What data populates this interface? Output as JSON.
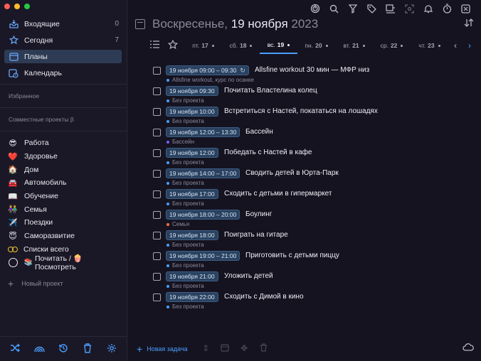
{
  "sidebar": {
    "nav": [
      {
        "label": "Входящие",
        "count": "0",
        "icon": "inbox-icon"
      },
      {
        "label": "Сегодня",
        "count": "7",
        "icon": "star-icon"
      },
      {
        "label": "Планы",
        "count": "",
        "icon": "plans-icon"
      },
      {
        "label": "Календарь",
        "count": "",
        "icon": "calendar-icon"
      }
    ],
    "favorites_label": "Избранное",
    "shared_label": "Совместные проекты β",
    "projects": [
      {
        "label": "Работа",
        "emoji": "😎"
      },
      {
        "label": "Здоровье",
        "emoji": "❤️"
      },
      {
        "label": "Дом",
        "emoji": "🏠"
      },
      {
        "label": "Автомобиль",
        "emoji": "🚘"
      },
      {
        "label": "Обучение",
        "emoji": "📖"
      },
      {
        "label": "Семья",
        "emoji": "👫"
      },
      {
        "label": "Поездки",
        "emoji": "✈️"
      },
      {
        "label": "Саморазвитие",
        "emoji": "😇"
      },
      {
        "label": "Списки всего",
        "emoji": ""
      },
      {
        "label": "Почитать / 🍿 Посмотреть",
        "emoji": "📚"
      }
    ],
    "new_project": "Новый проект"
  },
  "header": {
    "title_weekday": "Воскресенье,",
    "title_date": "19 ноября",
    "title_year": "2023"
  },
  "week": {
    "days": [
      {
        "label": "пт.",
        "num": "17"
      },
      {
        "label": "сб.",
        "num": "18"
      },
      {
        "label": "вс.",
        "num": "19"
      },
      {
        "label": "пн.",
        "num": "20"
      },
      {
        "label": "вт.",
        "num": "21"
      },
      {
        "label": "ср.",
        "num": "22"
      },
      {
        "label": "чт.",
        "num": "23"
      }
    ],
    "active_index": 2
  },
  "tasks": [
    {
      "date": "19 ноября 09:00 – 09:30",
      "name": "Allsfine workout 30 мин — МФР низ",
      "project": "Allsfine workout, курс по осанке",
      "project_color": "#4a9eff",
      "repeat": true
    },
    {
      "date": "19 ноября 09:30",
      "name": "Почитать Властелина колец",
      "project": "Без проекта",
      "project_color": "#4a9eff",
      "repeat": false
    },
    {
      "date": "19 ноября 10:00",
      "name": "Встретиться с Настей, покататься на лошадях",
      "project": "Без проекта",
      "project_color": "#4a9eff",
      "repeat": false
    },
    {
      "date": "19 ноября 12:00 – 13:30",
      "name": "Бассейн",
      "project": "Бассейн",
      "project_color": "#7b5cff",
      "repeat": false
    },
    {
      "date": "19 ноября 12:00",
      "name": "Победать с Настей в кафе",
      "project": "Без проекта",
      "project_color": "#4a9eff",
      "repeat": false
    },
    {
      "date": "19 ноября 14:00 – 17:00",
      "name": "Сводить детей в Юрта-Парк",
      "project": "Без проекта",
      "project_color": "#4a9eff",
      "repeat": false
    },
    {
      "date": "19 ноября 17:00",
      "name": "Сходить с детьми в гипермаркет",
      "project": "Без проекта",
      "project_color": "#4a9eff",
      "repeat": false
    },
    {
      "date": "19 ноября 18:00 – 20:00",
      "name": "Боулинг",
      "project": "Семья",
      "project_color": "#ff6b4a",
      "repeat": false
    },
    {
      "date": "19 ноября 18:00",
      "name": "Поиграть на гитаре",
      "project": "Без проекта",
      "project_color": "#4a9eff",
      "repeat": false
    },
    {
      "date": "19 ноября 19:00 – 21:00",
      "name": "Приготовить с детьми пиццу",
      "project": "Без проекта",
      "project_color": "#4a9eff",
      "repeat": false
    },
    {
      "date": "19 ноября 21:00",
      "name": "Уложить детей",
      "project": "Без проекта",
      "project_color": "#4a9eff",
      "repeat": false
    },
    {
      "date": "19 ноября 22:00",
      "name": "Сходить с Димой в кино",
      "project": "Без проекта",
      "project_color": "#4a9eff",
      "repeat": false
    }
  ],
  "footer": {
    "new_task": "Новая задача"
  },
  "colors": {
    "accent": "#4a9eff",
    "background": "#151320",
    "sidebar": "#1a1826",
    "date_chip": "#2a4260"
  }
}
